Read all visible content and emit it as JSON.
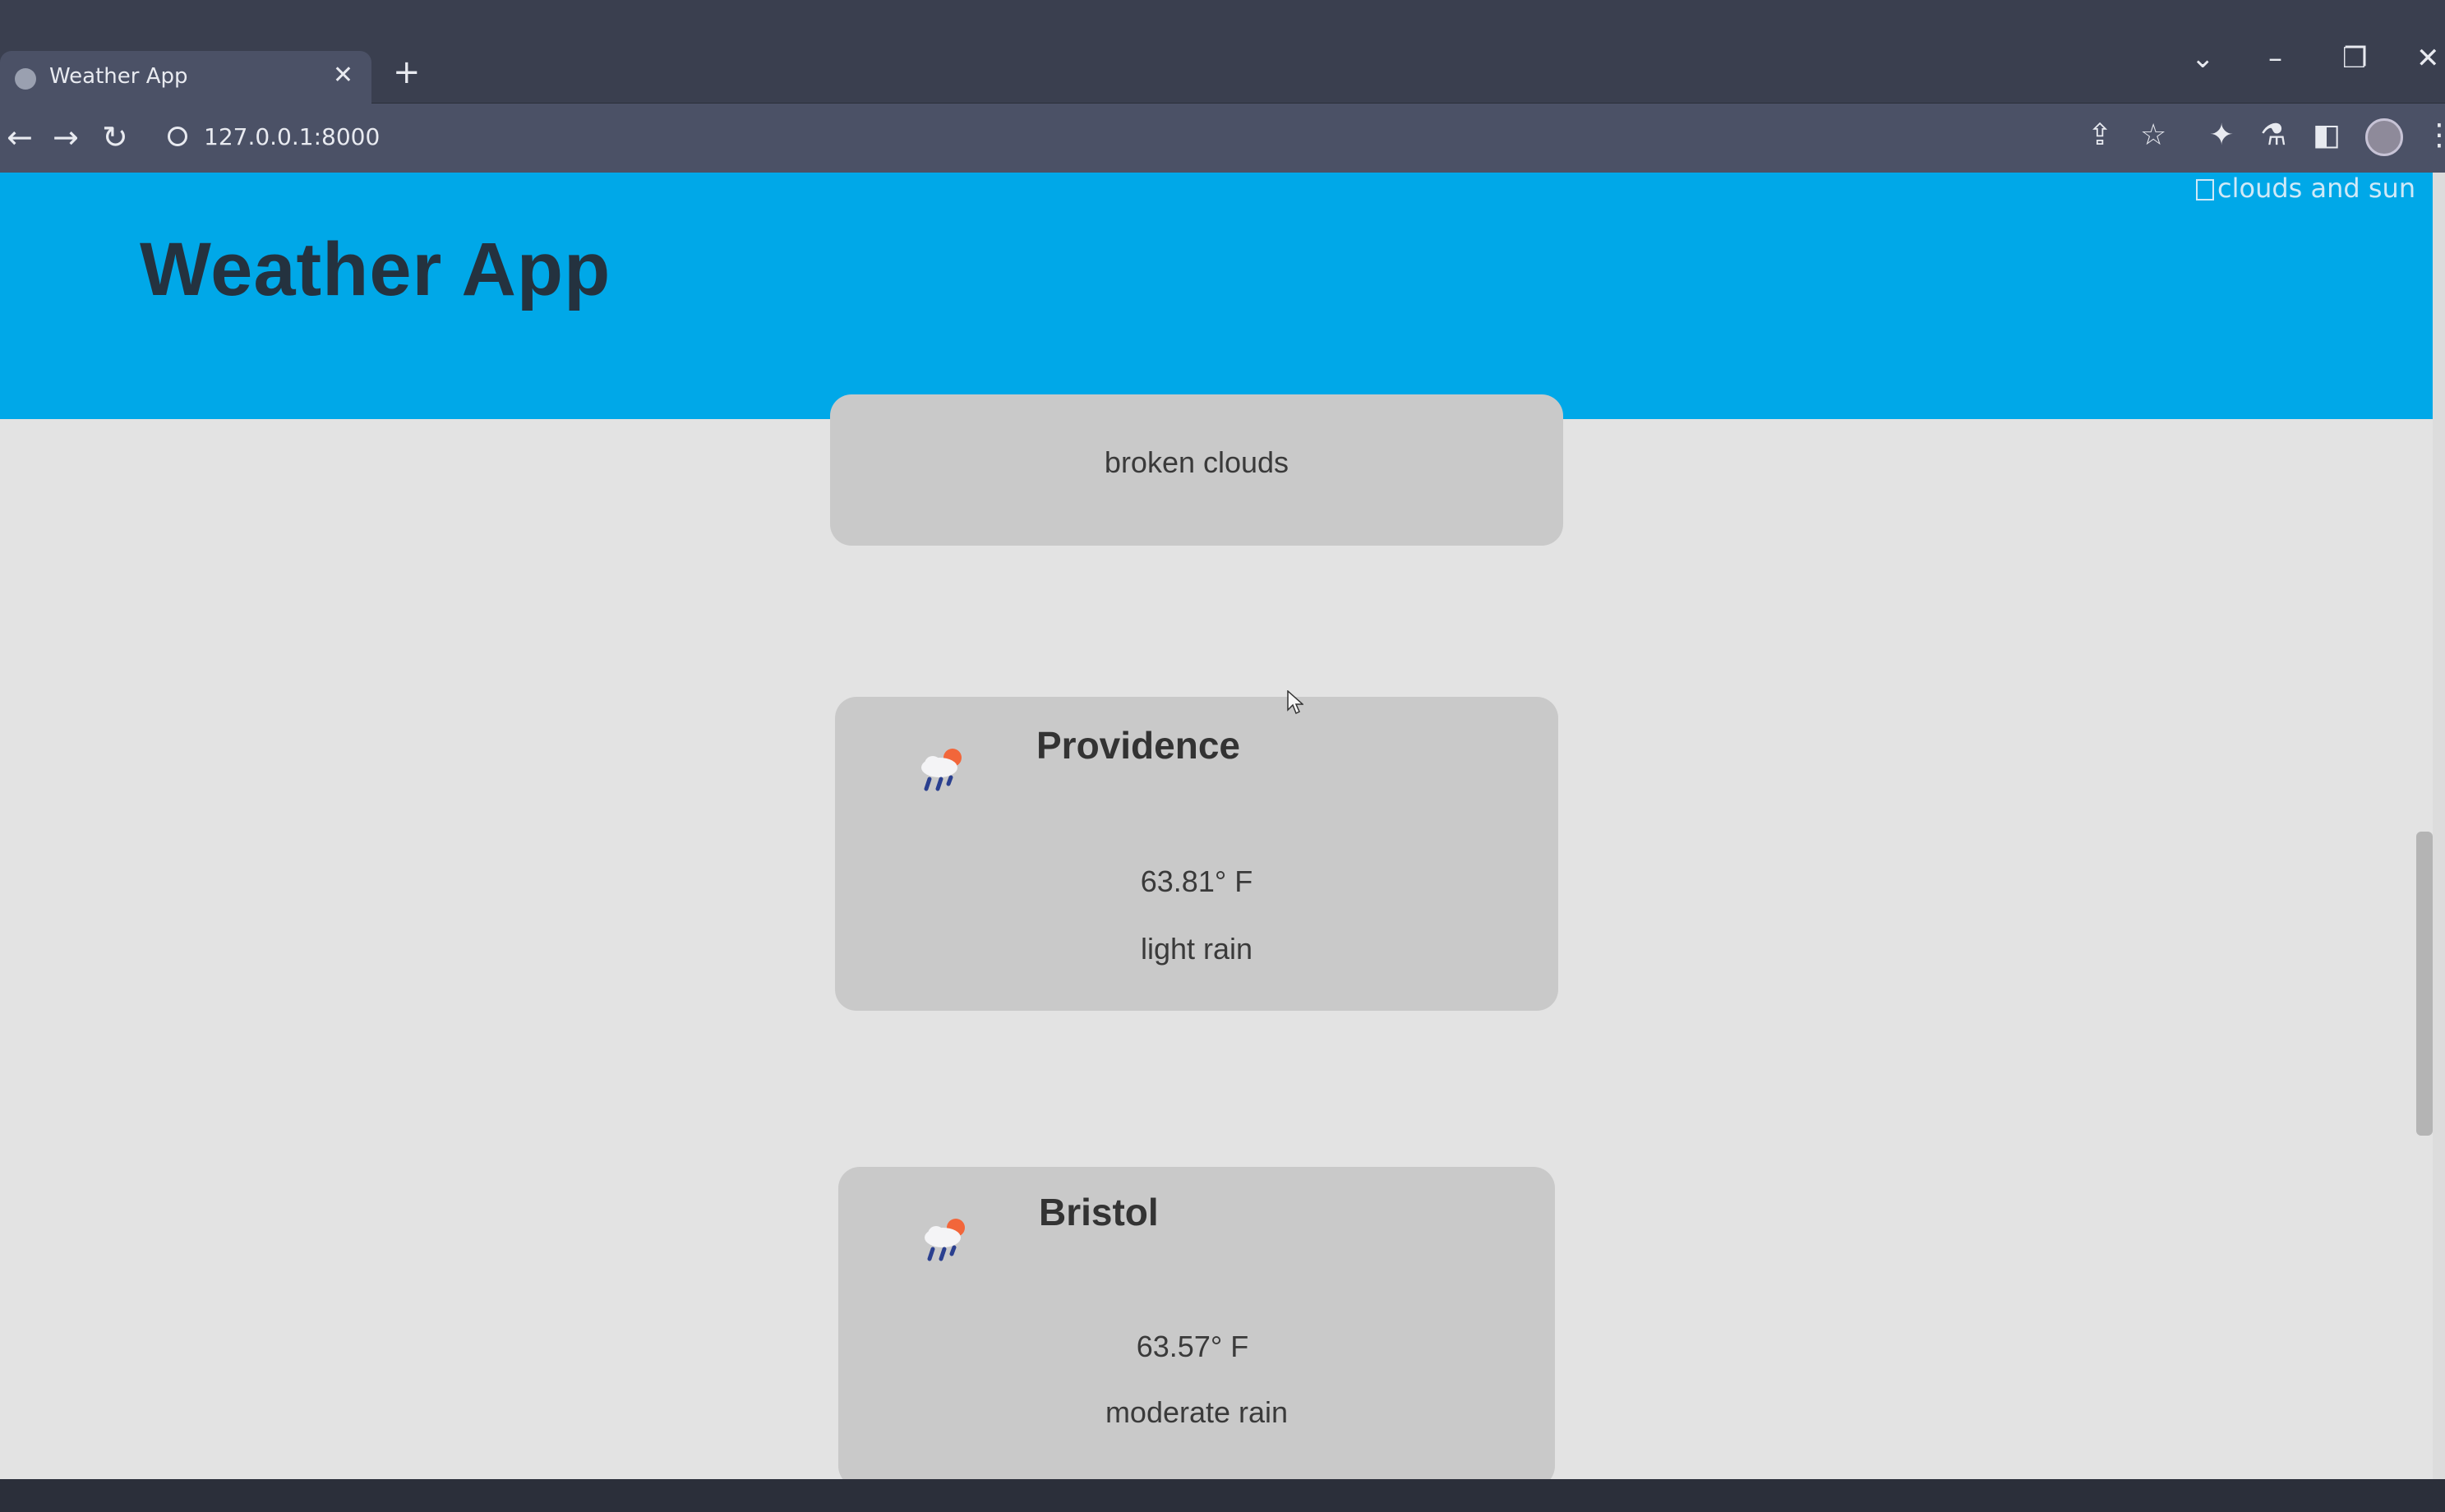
{
  "browser": {
    "tab_title": "Weather App",
    "tab_close": "✕",
    "new_tab": "+",
    "url": "127.0.0.1:8000",
    "back": "←",
    "forward": "→",
    "reload": "↻",
    "window_controls": {
      "dropdown": "⌄",
      "minimize": "–",
      "restore": "❐",
      "close": "✕"
    }
  },
  "header": {
    "title": "Weather App",
    "image_alt": "clouds and sun",
    "background": "#00a8e8"
  },
  "cards": [
    {
      "city": "",
      "temperature": "",
      "description": "broken clouds"
    },
    {
      "city": "Providence",
      "temperature": "63.81° F",
      "description": "light rain",
      "icon": "rain-sun-icon"
    },
    {
      "city": "Bristol",
      "temperature": "63.57° F",
      "description": "moderate rain",
      "icon": "rain-sun-icon"
    }
  ]
}
